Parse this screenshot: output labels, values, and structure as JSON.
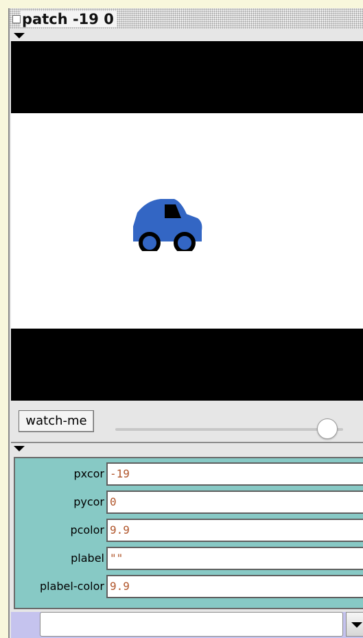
{
  "window": {
    "title": "patch -19 0"
  },
  "controls": {
    "watch_label": "watch-me",
    "zoom_slider_value": 0.93
  },
  "properties": [
    {
      "label": "pxcor",
      "value": "-19"
    },
    {
      "label": "pycor",
      "value": "0"
    },
    {
      "label": "pcolor",
      "value": "9.9"
    },
    {
      "label": "plabel",
      "value": "\"\""
    },
    {
      "label": "plabel-color",
      "value": "9.9"
    }
  ],
  "command": {
    "value": ""
  },
  "colors": {
    "car": "#3366c4",
    "road": "#000000",
    "patch": "#ffffff",
    "properties_panel": "#87c9c5",
    "value_text": "#b0552a",
    "command_strip": "#c5c3ee"
  },
  "icons": {
    "turtle_shape": "car-icon",
    "collapse": "triangle-down-icon",
    "dropdown": "triangle-down-icon"
  }
}
